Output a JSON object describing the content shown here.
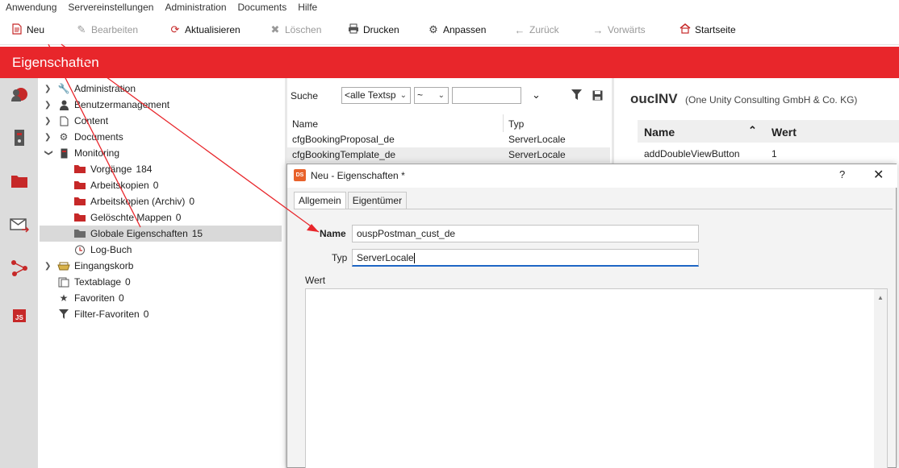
{
  "menu": [
    "Anwendung",
    "Servereinstellungen",
    "Administration",
    "Documents",
    "Hilfe"
  ],
  "toolbar": {
    "neu": "Neu",
    "bearbeiten": "Bearbeiten",
    "aktualisieren": "Aktualisieren",
    "loeschen": "Löschen",
    "drucken": "Drucken",
    "anpassen": "Anpassen",
    "zurueck": "Zurück",
    "vorwaerts": "Vorwärts",
    "startseite": "Startseite"
  },
  "page_title": "Eigenschaften",
  "rail_icons": [
    "user-globe-icon",
    "server-icon",
    "folder-icon",
    "mail-icon",
    "workflow-icon",
    "js-icon"
  ],
  "tree": [
    {
      "label": "Administration",
      "count": "",
      "icon": "wrench-icon"
    },
    {
      "label": "Benutzermanagement",
      "count": "",
      "icon": "user-icon"
    },
    {
      "label": "Content",
      "count": "",
      "icon": "document-icon"
    },
    {
      "label": "Documents",
      "count": "",
      "icon": "gear-icon"
    },
    {
      "label": "Monitoring",
      "count": "",
      "icon": "server-icon"
    },
    {
      "label": "Vorgänge",
      "count": "184",
      "icon": "red-folder-icon"
    },
    {
      "label": "Arbeitskopien",
      "count": "0",
      "icon": "red-folder-icon"
    },
    {
      "label": "Arbeitskopien (Archiv)",
      "count": "0",
      "icon": "red-folder-icon"
    },
    {
      "label": "Gelöschte Mappen",
      "count": "0",
      "icon": "red-folder-icon"
    },
    {
      "label": "Globale Eigenschaften",
      "count": "15",
      "icon": "grey-folder-icon"
    },
    {
      "label": "Log-Buch",
      "count": "",
      "icon": "logbook-icon"
    },
    {
      "label": "Eingangskorb",
      "count": "",
      "icon": "inbox-icon"
    },
    {
      "label": "Textablage",
      "count": "0",
      "icon": "text-storage-icon"
    },
    {
      "label": "Favoriten",
      "count": "0",
      "icon": "star-icon"
    },
    {
      "label": "Filter-Favoriten",
      "count": "0",
      "icon": "filter-icon"
    }
  ],
  "search": {
    "label": "Suche",
    "field_value": "<alle Textsp",
    "operator_value": "~",
    "query_value": ""
  },
  "list": {
    "col_name": "Name",
    "col_typ": "Typ",
    "rows": [
      {
        "name": "cfgBookingProposal_de",
        "typ": "ServerLocale"
      },
      {
        "name": "cfgBookingTemplate_de",
        "typ": "ServerLocale"
      }
    ]
  },
  "detail": {
    "title": "oucINV",
    "subtitle": "(One Unity Consulting GmbH & Co. KG)",
    "col_name": "Name",
    "col_wert": "Wert",
    "row_name": "addDoubleViewButton",
    "row_wert": "1"
  },
  "dialog": {
    "logo": "DS",
    "title": "Neu - Eigenschaften *",
    "help": "?",
    "close": "✕",
    "tabs": [
      "Allgemein",
      "Eigentümer"
    ],
    "name_label": "Name",
    "name_value": "ouspPostman_cust_de",
    "typ_label": "Typ",
    "typ_value": "ServerLocale",
    "wert_label": "Wert"
  },
  "colors": {
    "accent": "#e8262b",
    "annotation_arrow": "#e8262b"
  }
}
